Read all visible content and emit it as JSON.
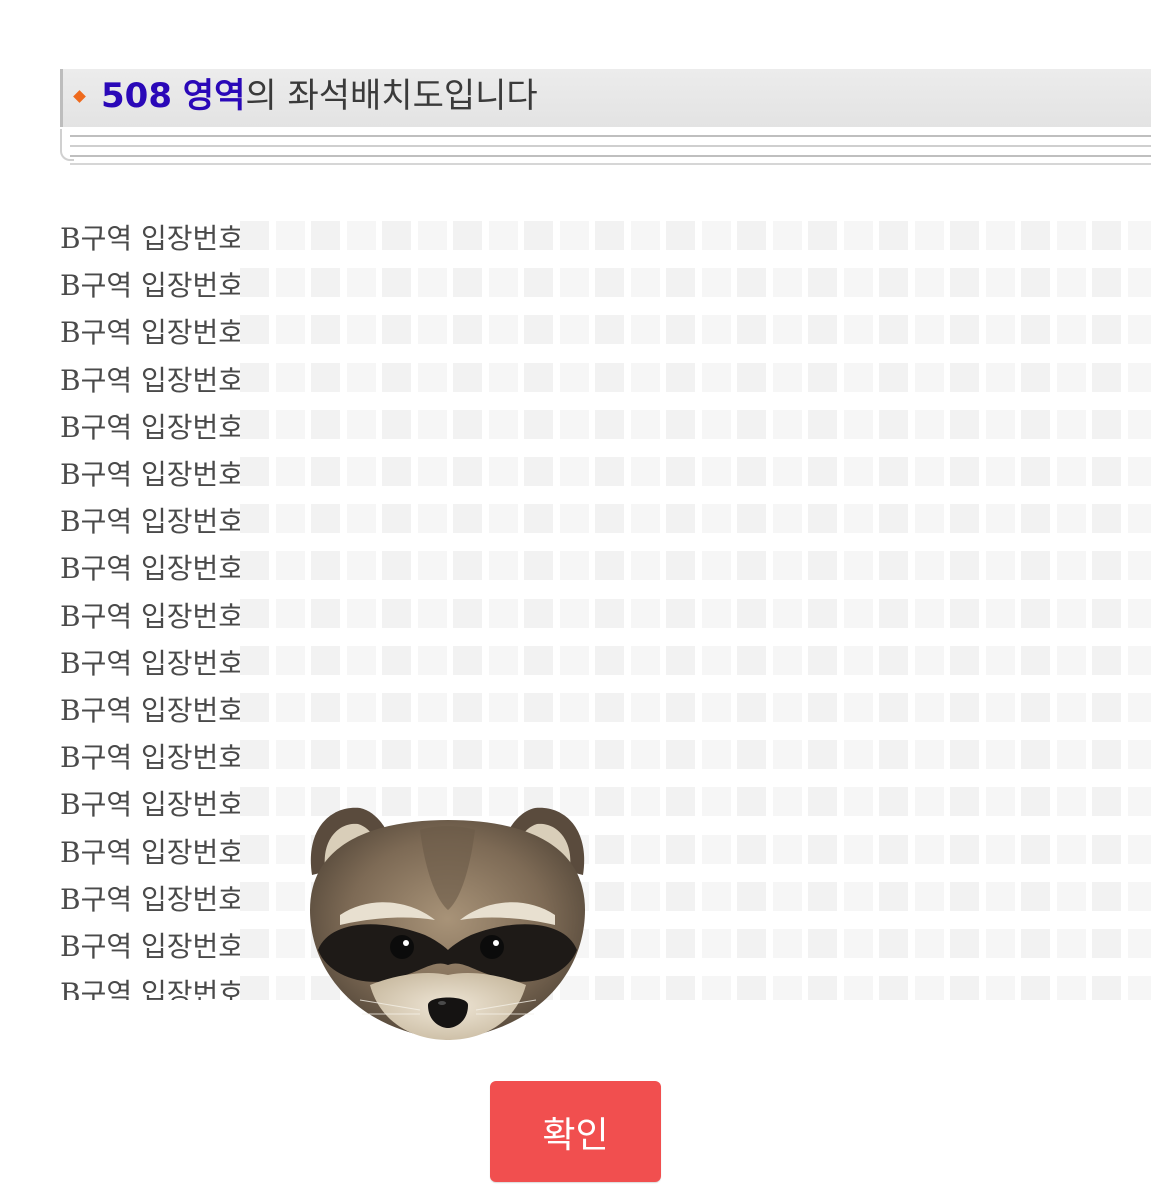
{
  "header": {
    "bullet_icon": "diamond-bullet-icon",
    "area_number": "508",
    "area_word": "영역",
    "title_rest": "의 좌석배치도입니다"
  },
  "seatmap": {
    "row_label": "B구역 입장번호",
    "row_count": 17,
    "seats_per_row": 26,
    "seat_color": "#f2f2f2"
  },
  "illustration": {
    "icon": "raccoon-face-icon"
  },
  "footer": {
    "confirm_label": "확인",
    "confirm_color": "#f14f4f"
  },
  "colors": {
    "accent_blue": "#2a08b8",
    "bullet_orange": "#ee6a1d"
  }
}
